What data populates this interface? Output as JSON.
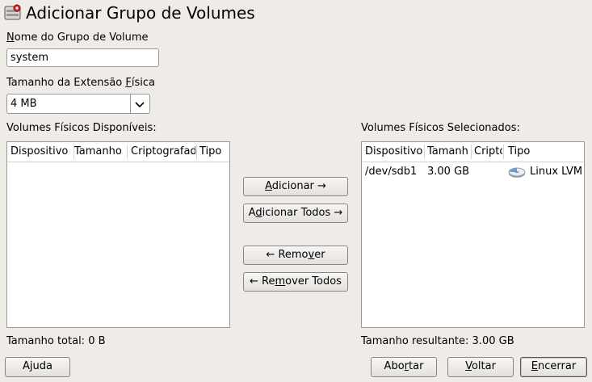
{
  "window": {
    "title": "Adicionar Grupo de Volumes"
  },
  "form": {
    "name_label": "Nome do Grupo de Volume",
    "name_value": "system",
    "extent_label": "Tamanho da Extensão Física",
    "extent_value": "4 MB"
  },
  "available": {
    "label": "Volumes Físicos Disponíveis:",
    "columns": [
      "Dispositivo",
      "Tamanho",
      "Criptografad",
      "Tipo"
    ],
    "rows": [],
    "total": "Tamanho total: 0 B"
  },
  "selected": {
    "label": "Volumes Físicos Selecionados:",
    "columns": [
      "Dispositivo",
      "Tamanh",
      "Cripto",
      "Tipo"
    ],
    "rows": [
      {
        "device": "/dev/sdb1",
        "size": "3.00 GB",
        "crypt": "",
        "type": "Linux LVM",
        "type_icon": "disk-icon"
      }
    ],
    "total": "Tamanho resultante: 3.00 GB"
  },
  "actions": {
    "add": "Adicionar →",
    "add_all": "Adicionar Todos →",
    "remove": "← Remover",
    "remove_all": "← Remover Todos"
  },
  "footer": {
    "help": "Ajuda",
    "abort": "Abortar",
    "back": "Voltar",
    "finish": "Encerrar"
  }
}
